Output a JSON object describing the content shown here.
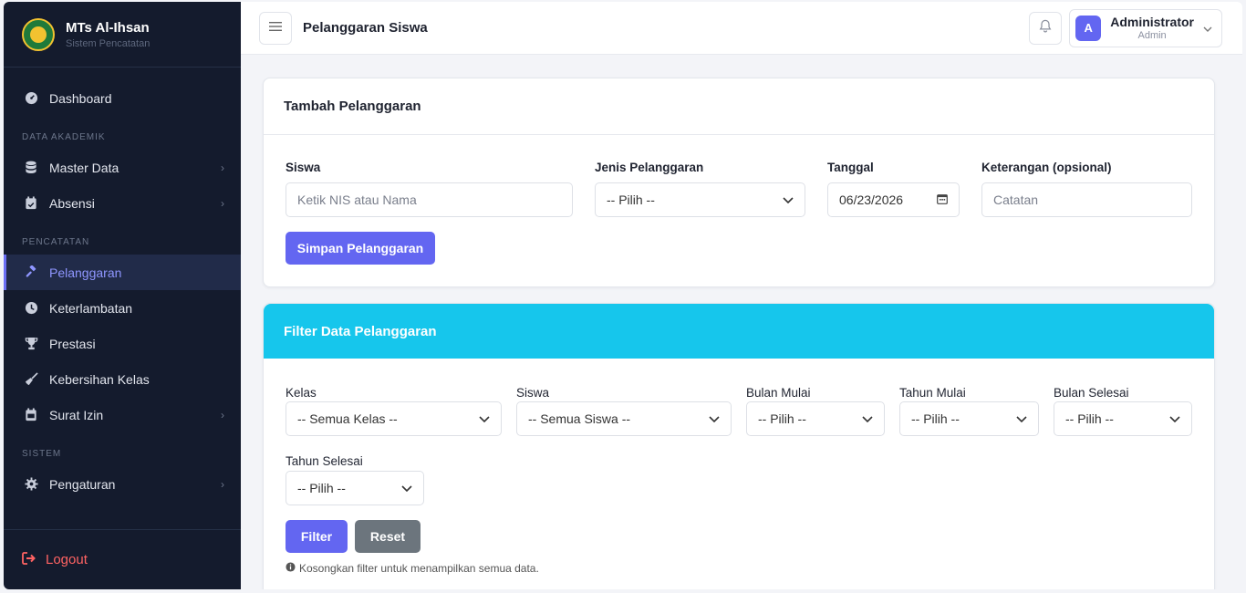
{
  "app": {
    "name": "MTs Al-Ihsan",
    "subtitle": "Sistem Pencatatan"
  },
  "sidebar": {
    "dashboard": "Dashboard",
    "section_akademik": "DATA AKADEMIK",
    "master_data": "Master Data",
    "absensi": "Absensi",
    "section_pencatatan": "PENCATATAN",
    "pelanggaran": "Pelanggaran",
    "keterlambatan": "Keterlambatan",
    "prestasi": "Prestasi",
    "kebersihan": "Kebersihan Kelas",
    "surat_izin": "Surat Izin",
    "section_sistem": "SISTEM",
    "pengaturan": "Pengaturan",
    "logout": "Logout"
  },
  "header": {
    "title": "Pelanggaran Siswa",
    "user_initial": "A",
    "user_name": "Administrator",
    "user_role": "Admin"
  },
  "add_form": {
    "title": "Tambah Pelanggaran",
    "siswa_label": "Siswa",
    "siswa_placeholder": "Ketik NIS atau Nama",
    "jenis_label": "Jenis Pelanggaran",
    "jenis_value": "-- Pilih --",
    "tanggal_label": "Tanggal",
    "tanggal_value": "06/23/2026",
    "keterangan_label": "Keterangan (opsional)",
    "keterangan_placeholder": "Catatan",
    "submit": "Simpan Pelanggaran"
  },
  "filter": {
    "title": "Filter Data Pelanggaran",
    "kelas_label": "Kelas",
    "kelas_value": "-- Semua Kelas --",
    "siswa_label": "Siswa",
    "siswa_value": "-- Semua Siswa --",
    "bulan_mulai_label": "Bulan Mulai",
    "bulan_mulai_value": "-- Pilih --",
    "tahun_mulai_label": "Tahun Mulai",
    "tahun_mulai_value": "-- Pilih --",
    "bulan_selesai_label": "Bulan Selesai",
    "bulan_selesai_value": "-- Pilih --",
    "tahun_selesai_label": "Tahun Selesai",
    "tahun_selesai_value": "-- Pilih --",
    "filter_btn": "Filter",
    "reset_btn": "Reset",
    "note": "Kosongkan filter untuk menampilkan semua data."
  },
  "colors": {
    "primary": "#6366f1",
    "sidebar_bg": "#141b2d",
    "filter_header": "#16c6ec",
    "logout": "#ff6363"
  }
}
